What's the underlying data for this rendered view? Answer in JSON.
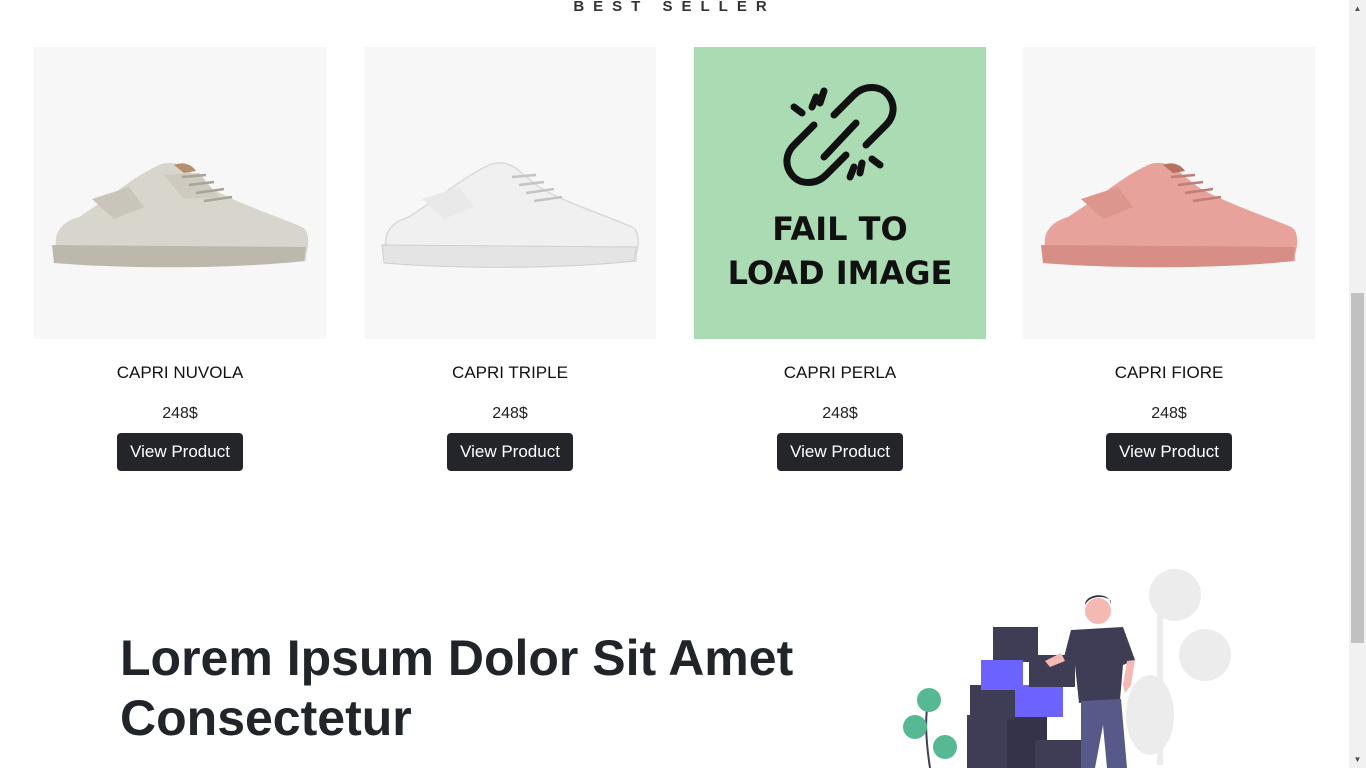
{
  "section": {
    "title": "BEST SELLER"
  },
  "products": [
    {
      "name": "CAPRI NUVOLA",
      "price": "248$",
      "button": "View Product",
      "image": "grey-sneaker"
    },
    {
      "name": "CAPRI TRIPLE",
      "price": "248$",
      "button": "View Product",
      "image": "white-sneaker"
    },
    {
      "name": "CAPRI PERLA",
      "price": "248$",
      "button": "View Product",
      "image": "broken-link-icon",
      "image_error": [
        "FAIL TO",
        "LOAD IMAGE"
      ]
    },
    {
      "name": "CAPRI FIORE",
      "price": "248$",
      "button": "View Product",
      "image": "pink-sneaker"
    }
  ],
  "hero": {
    "heading": "Lorem Ipsum Dolor Sit Amet Consectetur"
  },
  "colors": {
    "button_bg": "#23252b",
    "image_bg": "#f7f7f7",
    "fail_bg": "#abdbb3",
    "accent_boxes": "#6c63ff",
    "dark_boxes": "#3f3d56"
  },
  "icons": [
    "broken-link-icon",
    "chevron-up-icon",
    "chevron-down-icon"
  ]
}
